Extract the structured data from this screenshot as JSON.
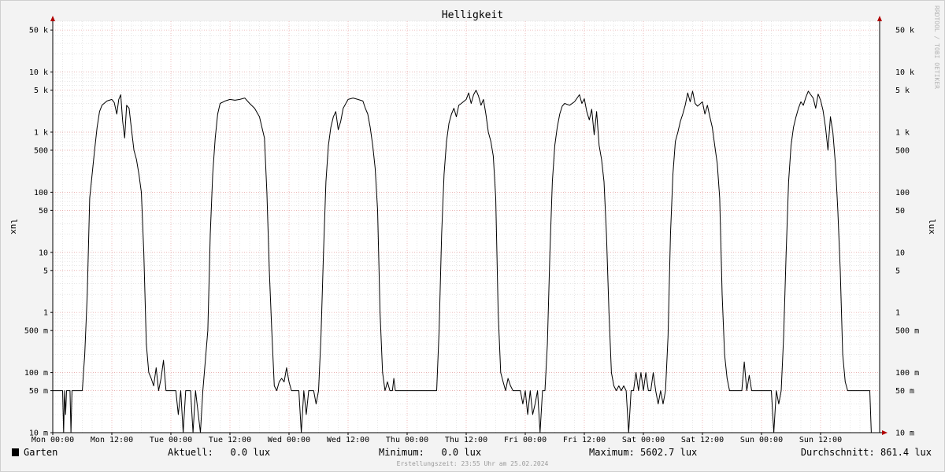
{
  "chart_data": {
    "type": "line",
    "title": "Helligkeit",
    "ylabel": "lux",
    "yscale": "log",
    "ylim": [
      0.01,
      70000
    ],
    "xlim": [
      0,
      168
    ],
    "grid": true,
    "x_ticks": [
      {
        "x": 0,
        "label": "Mon 00:00"
      },
      {
        "x": 12,
        "label": "Mon 12:00"
      },
      {
        "x": 24,
        "label": "Tue 00:00"
      },
      {
        "x": 36,
        "label": "Tue 12:00"
      },
      {
        "x": 48,
        "label": "Wed 00:00"
      },
      {
        "x": 60,
        "label": "Wed 12:00"
      },
      {
        "x": 72,
        "label": "Thu 00:00"
      },
      {
        "x": 84,
        "label": "Thu 12:00"
      },
      {
        "x": 96,
        "label": "Fri 00:00"
      },
      {
        "x": 108,
        "label": "Fri 12:00"
      },
      {
        "x": 120,
        "label": "Sat 00:00"
      },
      {
        "x": 132,
        "label": "Sat 12:00"
      },
      {
        "x": 144,
        "label": "Sun 00:00"
      },
      {
        "x": 156,
        "label": "Sun 12:00"
      }
    ],
    "y_ticks": [
      {
        "v": 0.01,
        "label": "10 m"
      },
      {
        "v": 0.05,
        "label": "50 m"
      },
      {
        "v": 0.1,
        "label": "100 m"
      },
      {
        "v": 0.5,
        "label": "500 m"
      },
      {
        "v": 1,
        "label": "1"
      },
      {
        "v": 5,
        "label": "5"
      },
      {
        "v": 10,
        "label": "10"
      },
      {
        "v": 50,
        "label": "50"
      },
      {
        "v": 100,
        "label": "100"
      },
      {
        "v": 500,
        "label": "500"
      },
      {
        "v": 1000,
        "label": "1 k"
      },
      {
        "v": 5000,
        "label": "5 k"
      },
      {
        "v": 10000,
        "label": "10 k"
      },
      {
        "v": 50000,
        "label": "50 k"
      }
    ],
    "series": [
      {
        "name": "Garten",
        "color": "#000000",
        "points": [
          [
            0,
            0.05
          ],
          [
            2,
            0.05
          ],
          [
            2.2,
            0.01
          ],
          [
            2.4,
            0.05
          ],
          [
            2.6,
            0.02
          ],
          [
            2.8,
            0.05
          ],
          [
            3.5,
            0.05
          ],
          [
            3.7,
            0.01
          ],
          [
            3.9,
            0.05
          ],
          [
            5,
            0.05
          ],
          [
            6,
            0.05
          ],
          [
            6.5,
            0.2
          ],
          [
            7,
            2
          ],
          [
            7.5,
            80
          ],
          [
            8,
            200
          ],
          [
            8.5,
            500
          ],
          [
            9,
            1200
          ],
          [
            9.5,
            2200
          ],
          [
            10,
            2800
          ],
          [
            11,
            3300
          ],
          [
            12,
            3500
          ],
          [
            12.5,
            3100
          ],
          [
            13,
            2000
          ],
          [
            13.4,
            3500
          ],
          [
            13.8,
            4200
          ],
          [
            14.2,
            1500
          ],
          [
            14.6,
            800
          ],
          [
            15,
            2800
          ],
          [
            15.5,
            2500
          ],
          [
            16,
            1100
          ],
          [
            16.5,
            500
          ],
          [
            17,
            350
          ],
          [
            17.5,
            200
          ],
          [
            18,
            100
          ],
          [
            18.5,
            10
          ],
          [
            19,
            0.3
          ],
          [
            19.5,
            0.1
          ],
          [
            20,
            0.08
          ],
          [
            20.5,
            0.06
          ],
          [
            21,
            0.12
          ],
          [
            21.5,
            0.05
          ],
          [
            22,
            0.08
          ],
          [
            22.5,
            0.16
          ],
          [
            23,
            0.05
          ],
          [
            25,
            0.05
          ],
          [
            25.5,
            0.02
          ],
          [
            26,
            0.05
          ],
          [
            26.5,
            0.01
          ],
          [
            27,
            0.05
          ],
          [
            28,
            0.05
          ],
          [
            28.5,
            0.01
          ],
          [
            29,
            0.05
          ],
          [
            30,
            0.01
          ],
          [
            30.5,
            0.05
          ],
          [
            31.5,
            0.5
          ],
          [
            32,
            20
          ],
          [
            32.5,
            200
          ],
          [
            33,
            800
          ],
          [
            33.5,
            2000
          ],
          [
            34,
            3000
          ],
          [
            35,
            3300
          ],
          [
            36,
            3500
          ],
          [
            37,
            3400
          ],
          [
            38,
            3500
          ],
          [
            39,
            3700
          ],
          [
            40,
            3000
          ],
          [
            41,
            2500
          ],
          [
            42,
            1800
          ],
          [
            42.5,
            1200
          ],
          [
            43,
            800
          ],
          [
            43.5,
            100
          ],
          [
            44,
            5
          ],
          [
            44.5,
            0.5
          ],
          [
            45,
            0.06
          ],
          [
            45.5,
            0.05
          ],
          [
            46,
            0.07
          ],
          [
            46.5,
            0.08
          ],
          [
            47,
            0.07
          ],
          [
            47.5,
            0.12
          ],
          [
            48,
            0.07
          ],
          [
            48.5,
            0.05
          ],
          [
            50,
            0.05
          ],
          [
            50.5,
            0.01
          ],
          [
            51,
            0.05
          ],
          [
            51.5,
            0.02
          ],
          [
            52,
            0.05
          ],
          [
            53,
            0.05
          ],
          [
            53.5,
            0.03
          ],
          [
            54,
            0.05
          ],
          [
            54.5,
            0.4
          ],
          [
            55,
            10
          ],
          [
            55.5,
            150
          ],
          [
            56,
            600
          ],
          [
            56.5,
            1200
          ],
          [
            57,
            1800
          ],
          [
            57.5,
            2200
          ],
          [
            58,
            1100
          ],
          [
            58.5,
            1500
          ],
          [
            59,
            2500
          ],
          [
            60,
            3500
          ],
          [
            61,
            3700
          ],
          [
            62,
            3500
          ],
          [
            63,
            3300
          ],
          [
            63.5,
            2500
          ],
          [
            64,
            2000
          ],
          [
            64.5,
            1200
          ],
          [
            65,
            600
          ],
          [
            65.5,
            250
          ],
          [
            66,
            50
          ],
          [
            66.5,
            1
          ],
          [
            67,
            0.1
          ],
          [
            67.5,
            0.05
          ],
          [
            68,
            0.07
          ],
          [
            68.5,
            0.05
          ],
          [
            69,
            0.05
          ],
          [
            69.3,
            0.08
          ],
          [
            69.6,
            0.05
          ],
          [
            72,
            0.05
          ],
          [
            76,
            0.05
          ],
          [
            78,
            0.05
          ],
          [
            78.5,
            0.5
          ],
          [
            79,
            20
          ],
          [
            79.5,
            200
          ],
          [
            80,
            700
          ],
          [
            80.5,
            1400
          ],
          [
            81,
            2000
          ],
          [
            81.5,
            2500
          ],
          [
            82,
            1800
          ],
          [
            82.5,
            2800
          ],
          [
            83,
            3000
          ],
          [
            84,
            3500
          ],
          [
            84.5,
            4500
          ],
          [
            85,
            3000
          ],
          [
            85.5,
            4200
          ],
          [
            86,
            5000
          ],
          [
            86.5,
            4000
          ],
          [
            87,
            2800
          ],
          [
            87.5,
            3500
          ],
          [
            88,
            2000
          ],
          [
            88.5,
            1000
          ],
          [
            89,
            700
          ],
          [
            89.5,
            400
          ],
          [
            90,
            80
          ],
          [
            90.5,
            1
          ],
          [
            91,
            0.1
          ],
          [
            91.5,
            0.07
          ],
          [
            92,
            0.05
          ],
          [
            92.5,
            0.08
          ],
          [
            93,
            0.06
          ],
          [
            93.5,
            0.05
          ],
          [
            95,
            0.05
          ],
          [
            95.5,
            0.03
          ],
          [
            96,
            0.05
          ],
          [
            96.5,
            0.02
          ],
          [
            97,
            0.05
          ],
          [
            97.5,
            0.02
          ],
          [
            98,
            0.03
          ],
          [
            98.5,
            0.05
          ],
          [
            99,
            0.01
          ],
          [
            99.5,
            0.05
          ],
          [
            100,
            0.05
          ],
          [
            100.5,
            0.3
          ],
          [
            101,
            10
          ],
          [
            101.5,
            150
          ],
          [
            102,
            600
          ],
          [
            102.5,
            1200
          ],
          [
            103,
            2000
          ],
          [
            103.5,
            2700
          ],
          [
            104,
            3000
          ],
          [
            105,
            2800
          ],
          [
            106,
            3200
          ],
          [
            107,
            4200
          ],
          [
            107.5,
            3000
          ],
          [
            108,
            3600
          ],
          [
            108.5,
            2200
          ],
          [
            109,
            1600
          ],
          [
            109.5,
            2400
          ],
          [
            110,
            900
          ],
          [
            110.5,
            2200
          ],
          [
            111,
            600
          ],
          [
            111.5,
            350
          ],
          [
            112,
            150
          ],
          [
            112.5,
            20
          ],
          [
            113,
            1
          ],
          [
            113.5,
            0.1
          ],
          [
            114,
            0.06
          ],
          [
            114.5,
            0.05
          ],
          [
            115,
            0.06
          ],
          [
            115.5,
            0.05
          ],
          [
            116,
            0.06
          ],
          [
            116.5,
            0.05
          ],
          [
            117,
            0.01
          ],
          [
            117.5,
            0.05
          ],
          [
            118,
            0.05
          ],
          [
            118.5,
            0.1
          ],
          [
            119,
            0.05
          ],
          [
            119.5,
            0.1
          ],
          [
            120,
            0.05
          ],
          [
            120.5,
            0.1
          ],
          [
            121,
            0.05
          ],
          [
            121.5,
            0.05
          ],
          [
            122,
            0.1
          ],
          [
            122.5,
            0.05
          ],
          [
            123,
            0.03
          ],
          [
            123.5,
            0.05
          ],
          [
            124,
            0.03
          ],
          [
            124.5,
            0.05
          ],
          [
            125,
            0.4
          ],
          [
            125.5,
            20
          ],
          [
            126,
            200
          ],
          [
            126.5,
            700
          ],
          [
            127,
            1000
          ],
          [
            127.5,
            1500
          ],
          [
            128,
            2000
          ],
          [
            128.5,
            2800
          ],
          [
            129,
            4500
          ],
          [
            129.5,
            3200
          ],
          [
            130,
            4800
          ],
          [
            130.5,
            3000
          ],
          [
            131,
            2700
          ],
          [
            132,
            3200
          ],
          [
            132.5,
            2000
          ],
          [
            133,
            2800
          ],
          [
            133.5,
            1800
          ],
          [
            134,
            1200
          ],
          [
            134.5,
            600
          ],
          [
            135,
            300
          ],
          [
            135.5,
            80
          ],
          [
            136,
            2
          ],
          [
            136.5,
            0.2
          ],
          [
            137,
            0.08
          ],
          [
            137.5,
            0.05
          ],
          [
            140,
            0.05
          ],
          [
            140.5,
            0.15
          ],
          [
            141,
            0.05
          ],
          [
            141.5,
            0.09
          ],
          [
            142,
            0.05
          ],
          [
            144,
            0.05
          ],
          [
            146,
            0.05
          ],
          [
            146.5,
            0.01
          ],
          [
            147,
            0.05
          ],
          [
            147.5,
            0.03
          ],
          [
            148,
            0.05
          ],
          [
            148.5,
            0.4
          ],
          [
            149,
            10
          ],
          [
            149.5,
            150
          ],
          [
            150,
            600
          ],
          [
            150.5,
            1200
          ],
          [
            151,
            1800
          ],
          [
            151.5,
            2500
          ],
          [
            152,
            3200
          ],
          [
            152.5,
            2800
          ],
          [
            153,
            3800
          ],
          [
            153.5,
            4800
          ],
          [
            154,
            4200
          ],
          [
            154.5,
            3700
          ],
          [
            155,
            2500
          ],
          [
            155.5,
            4300
          ],
          [
            156,
            3400
          ],
          [
            156.5,
            2300
          ],
          [
            157,
            1200
          ],
          [
            157.5,
            500
          ],
          [
            158,
            1800
          ],
          [
            158.5,
            1000
          ],
          [
            159,
            300
          ],
          [
            159.5,
            50
          ],
          [
            160,
            5
          ],
          [
            160.5,
            0.2
          ],
          [
            161,
            0.07
          ],
          [
            161.5,
            0.05
          ],
          [
            166,
            0.05
          ],
          [
            166.3,
            0.01
          ]
        ]
      }
    ]
  },
  "watermark": "RRDTOOL / TOBI OETIKER",
  "legend": {
    "label": "Garten",
    "stats": [
      {
        "text": "Aktuell:   0.0 lux"
      },
      {
        "text": "Minimum:   0.0 lux"
      },
      {
        "text": "Maximum: 5602.7 lux"
      },
      {
        "text": "Durchschnitt: 861.4 lux"
      }
    ]
  },
  "footer": "Erstellungszeit: 23:55 Uhr am 25.02.2024"
}
